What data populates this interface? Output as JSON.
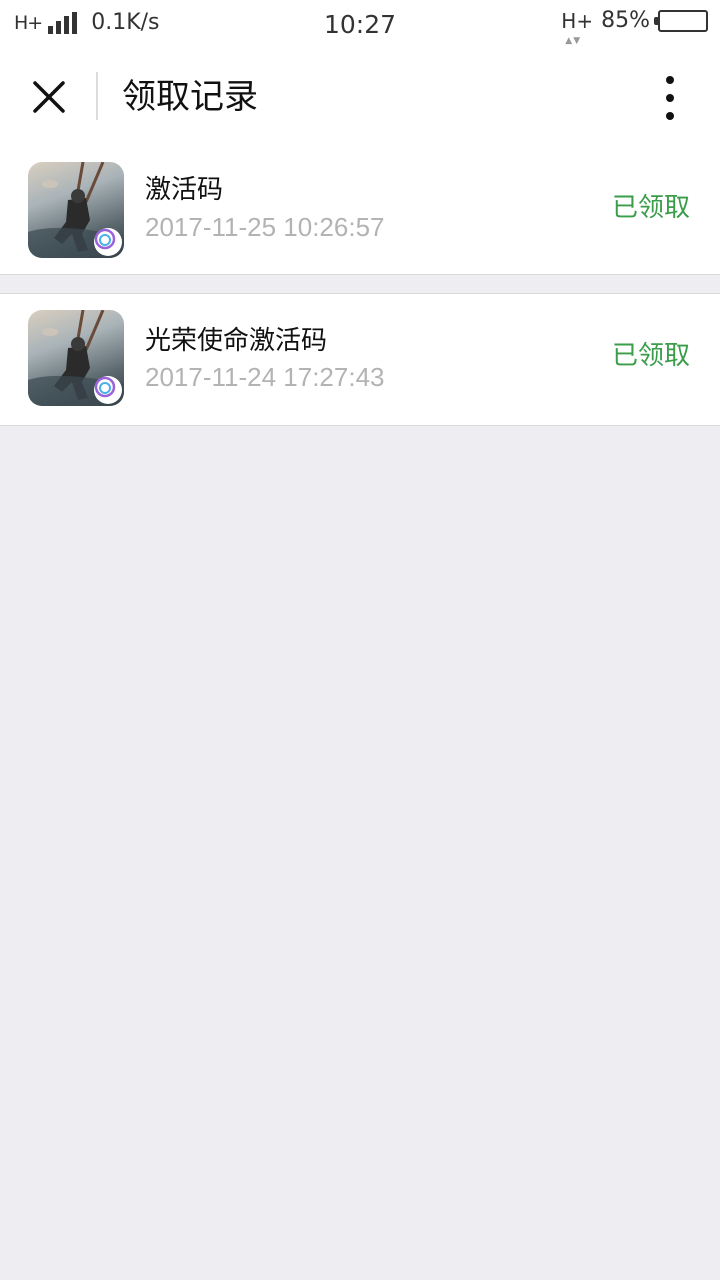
{
  "status_bar": {
    "network_left": "H+",
    "speed": "0.1K/s",
    "time": "10:27",
    "network_right": "H+",
    "battery": "85%",
    "battery_level": 0.85
  },
  "navbar": {
    "title": "领取记录",
    "close_icon": "close-icon",
    "more_icon": "more-vertical-icon"
  },
  "records": [
    {
      "title": "激活码",
      "time": "2017-11-25 10:26:57",
      "status": "已领取"
    },
    {
      "title": "光荣使命激活码",
      "time": "2017-11-24 17:27:43",
      "status": "已领取"
    }
  ],
  "colors": {
    "status_green": "#3a9d4a",
    "background": "#eeeef2",
    "timestamp_gray": "#b3b3b3"
  }
}
